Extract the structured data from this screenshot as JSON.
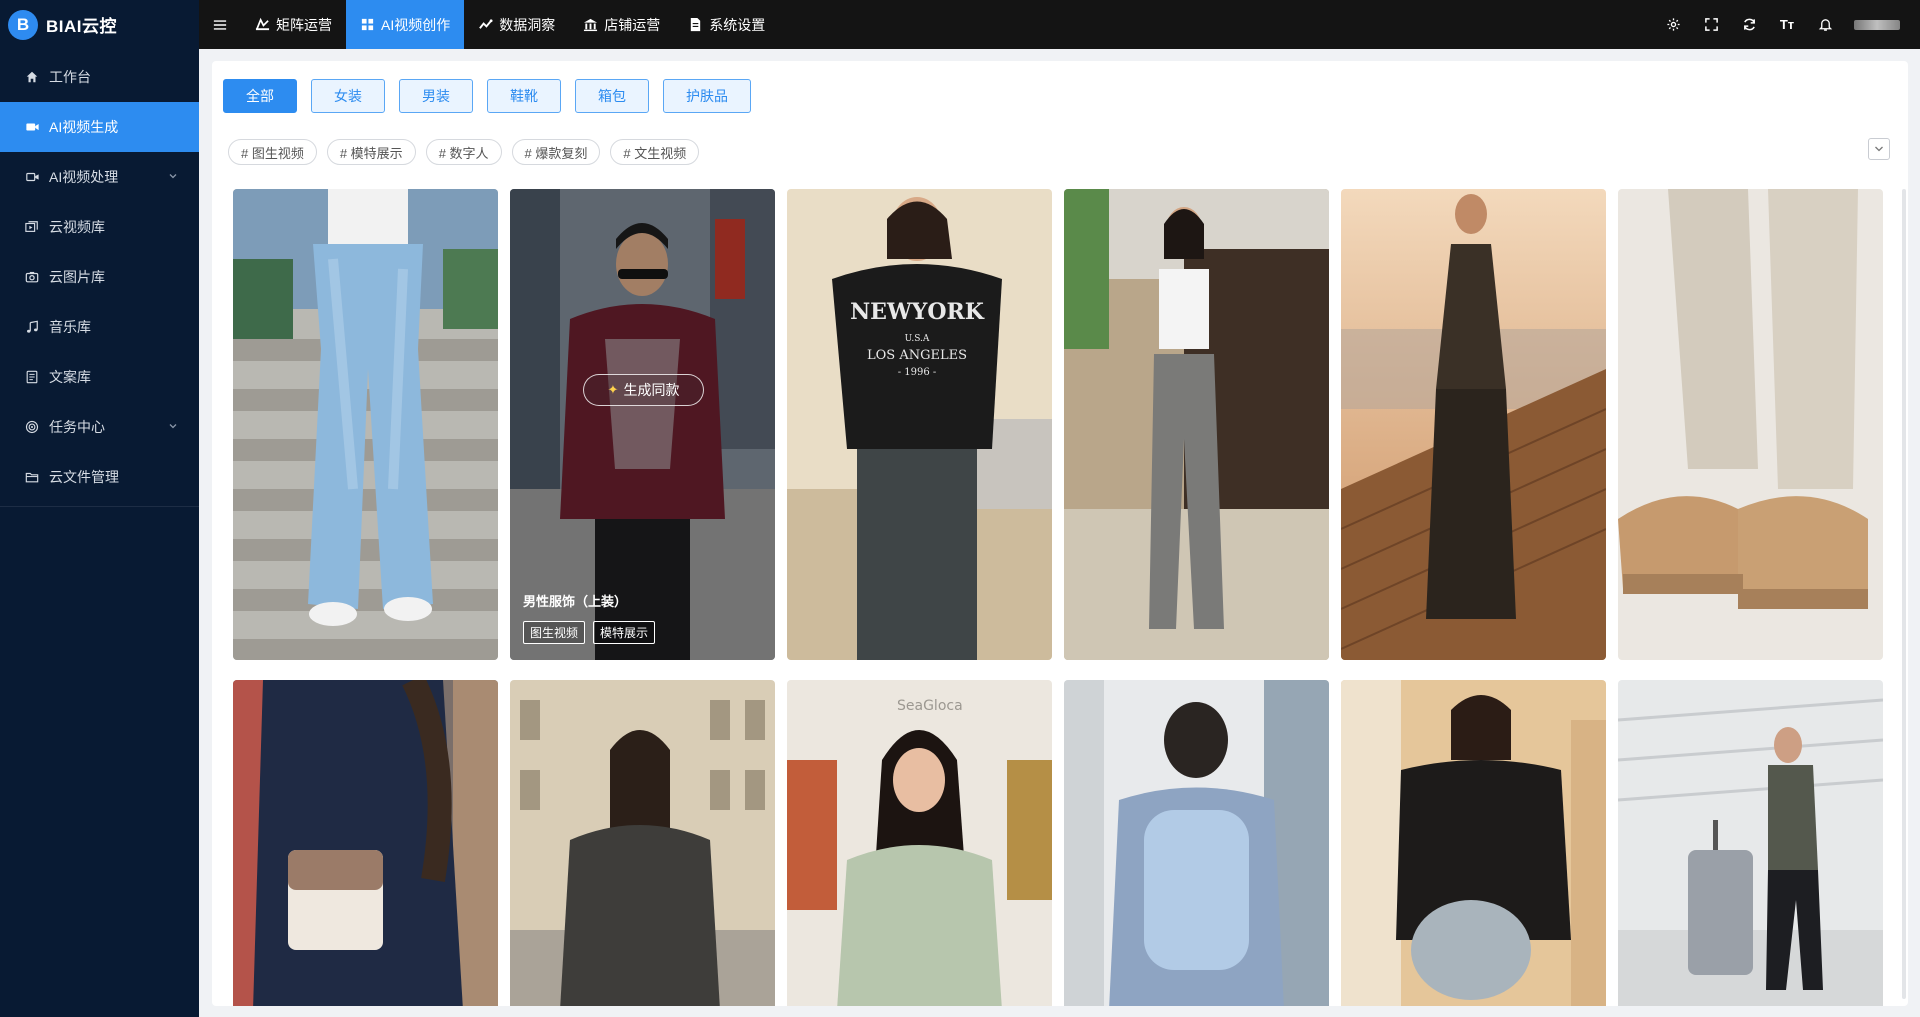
{
  "app": {
    "name": "BIAI云控"
  },
  "sidebar": {
    "items": [
      {
        "label": "工作台",
        "icon": "home-icon"
      },
      {
        "label": "AI视频生成",
        "icon": "video-icon",
        "active": true
      },
      {
        "label": "AI视频处理",
        "icon": "video-edit-icon",
        "expandable": true
      },
      {
        "label": "云视频库",
        "icon": "video-library-icon"
      },
      {
        "label": "云图片库",
        "icon": "camera-icon"
      },
      {
        "label": "音乐库",
        "icon": "music-icon"
      },
      {
        "label": "文案库",
        "icon": "document-icon"
      },
      {
        "label": "任务中心",
        "icon": "target-icon",
        "expandable": true
      },
      {
        "label": "云文件管理",
        "icon": "folder-icon"
      }
    ]
  },
  "topnav": {
    "tabs": [
      {
        "label": "矩阵运营",
        "icon": "broadcast-icon"
      },
      {
        "label": "AI视频创作",
        "icon": "grid-icon",
        "active": true
      },
      {
        "label": "数据洞察",
        "icon": "insight-icon"
      },
      {
        "label": "店铺运营",
        "icon": "store-icon"
      },
      {
        "label": "系统设置",
        "icon": "settings-doc-icon"
      }
    ],
    "right_icons": [
      "settings-icon",
      "fullscreen-icon",
      "refresh-icon",
      "font-size-icon",
      "bell-icon"
    ],
    "font_size_label": "Tт"
  },
  "categories": [
    {
      "label": "全部",
      "active": true
    },
    {
      "label": "女装"
    },
    {
      "label": "男装"
    },
    {
      "label": "鞋靴"
    },
    {
      "label": "箱包"
    },
    {
      "label": "护肤品"
    }
  ],
  "tags": [
    "# 图生视频",
    "# 模特展示",
    "# 数字人",
    "# 爆款复刻",
    "# 文生视频"
  ],
  "cards": [
    {
      "subject": "jeans-on-stairs"
    },
    {
      "subject": "man-in-shirt",
      "hover": true,
      "overlay_button": "生成同款",
      "caption": "男性服饰（上装）",
      "tags": [
        "图生视频",
        "模特展示"
      ]
    },
    {
      "subject": "newyork-tshirt",
      "print_text": [
        "NEWYORK",
        "U.S.A",
        "LOS ANGELES",
        "- 1996 -"
      ]
    },
    {
      "subject": "woman-cafe-street"
    },
    {
      "subject": "woman-dress-boardwalk"
    },
    {
      "subject": "sneakers-closeup"
    },
    {
      "subject": "woman-with-bag-street"
    },
    {
      "subject": "woman-paris-street"
    },
    {
      "subject": "woman-gallery",
      "sign_text": "SeaGloca"
    },
    {
      "subject": "man-backpack"
    },
    {
      "subject": "woman-leather-jacket"
    },
    {
      "subject": "man-airport-luggage"
    }
  ]
}
